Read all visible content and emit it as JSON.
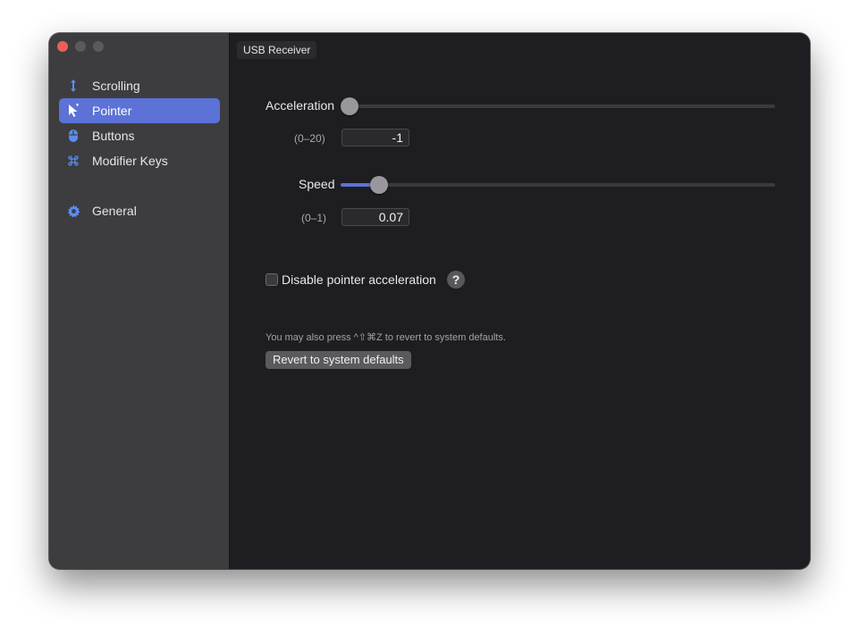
{
  "sidebar": {
    "items": [
      {
        "label": "Scrolling",
        "icon": "scroll-arrows-icon",
        "selected": false
      },
      {
        "label": "Pointer",
        "icon": "pointer-icon",
        "selected": true
      },
      {
        "label": "Buttons",
        "icon": "mouse-icon",
        "selected": false
      },
      {
        "label": "Modifier Keys",
        "icon": "command-key-icon",
        "selected": false
      },
      {
        "label": "General",
        "icon": "gear-icon",
        "selected": false
      }
    ]
  },
  "device_tab": {
    "label": "USB Receiver"
  },
  "acceleration": {
    "label": "Acceleration",
    "range": "(0–20)",
    "value": "-1",
    "slider_fraction": 0.0
  },
  "speed": {
    "label": "Speed",
    "range": "(0–1)",
    "value": "0.07",
    "slider_fraction": 0.07
  },
  "disable_accel": {
    "label": "Disable pointer acceleration",
    "checked": false,
    "help": "?"
  },
  "hint_text": "You may also press ^⇧⌘Z to revert to system defaults.",
  "revert_button": {
    "label": "Revert to system defaults"
  },
  "colors": {
    "accent": "#5c72d6",
    "window_bg": "#1e1e22",
    "sidebar_bg": "#3d3d40",
    "close_light": "#ec5f59"
  }
}
